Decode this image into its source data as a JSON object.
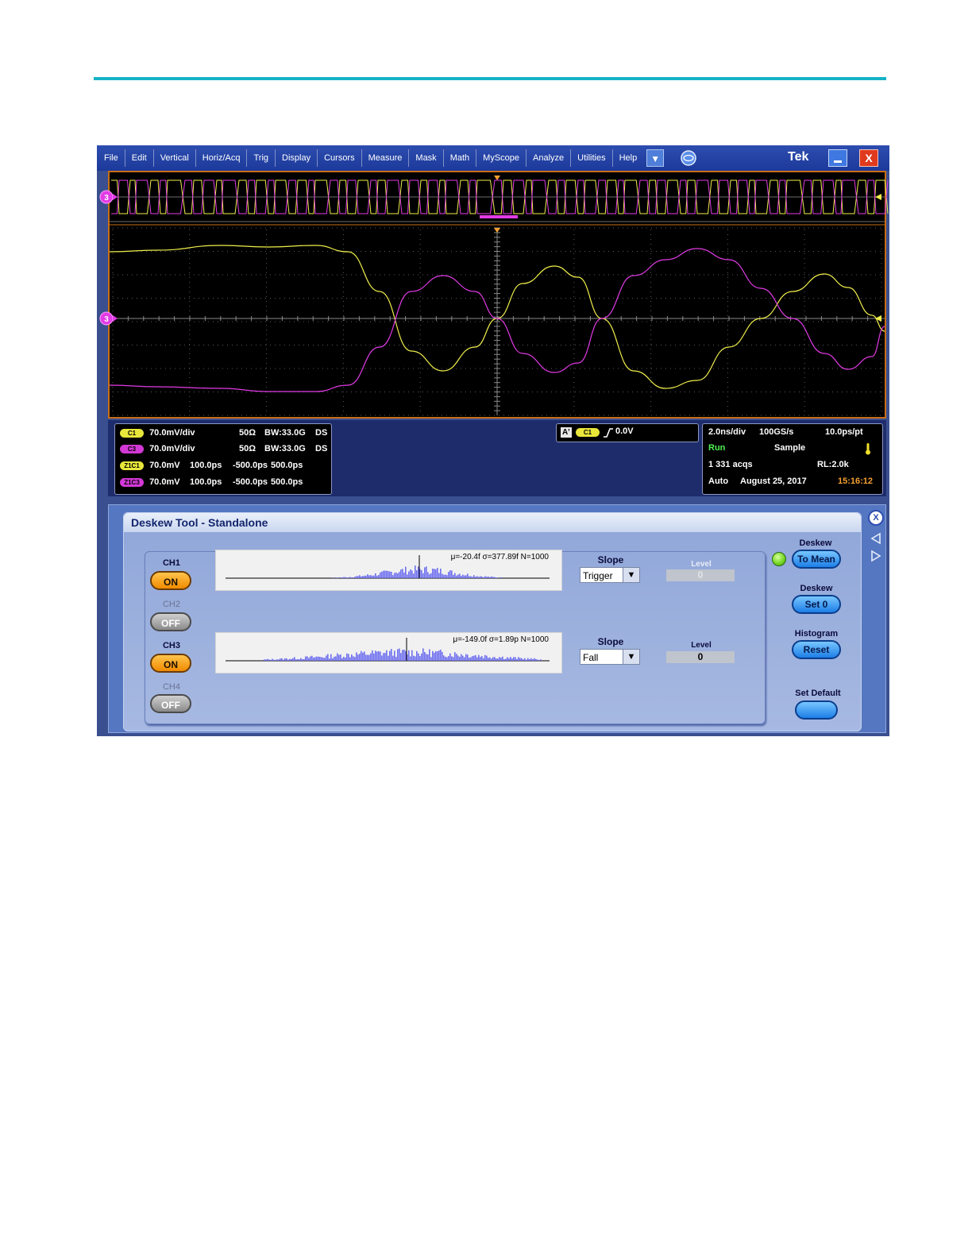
{
  "menu": {
    "items": [
      "File",
      "Edit",
      "Vertical",
      "Horiz/Acq",
      "Trig",
      "Display",
      "Cursors",
      "Measure",
      "Mask",
      "Math",
      "MyScope",
      "Analyze",
      "Utilities",
      "Help"
    ],
    "brand": "Tek",
    "close_glyph": "X"
  },
  "scope": {
    "marker": "3",
    "channel_colors": {
      "ch1": "#f0ef4a",
      "ch3": "#e23be6"
    }
  },
  "readouts": {
    "channels": [
      {
        "badge": "C1",
        "color": "#e8e63a",
        "scale": "70.0mV/div",
        "imp": "50Ω",
        "bw": "BW:33.0G",
        "ds": "DS"
      },
      {
        "badge": "C3",
        "color": "#d238d6",
        "scale": "70.0mV/div",
        "imp": "50Ω",
        "bw": "BW:33.0G",
        "ds": "DS"
      },
      {
        "badge": "Z1C1",
        "color": "#e8e63a",
        "scale": "70.0mV",
        "t1": "100.0ps",
        "t2": "-500.0ps",
        "t3": "500.0ps"
      },
      {
        "badge": "Z1C3",
        "color": "#d238d6",
        "scale": "70.0mV",
        "t1": "100.0ps",
        "t2": "-500.0ps",
        "t3": "500.0ps"
      }
    ],
    "trigger": {
      "mode": "A'",
      "source": "C1",
      "level": "0.0V"
    },
    "horizontal": {
      "timebase": "2.0ns/div",
      "rate": "100GS/s",
      "resolution": "10.0ps/pt",
      "state": "Run",
      "acq_mode": "Sample",
      "acqs": "1 331 acqs",
      "record_length": "RL:2.0k",
      "trigger_mode": "Auto",
      "date": "August 25, 2017",
      "time": "15:16:12"
    }
  },
  "deskew": {
    "title": "Deskew Tool - Standalone",
    "channels": [
      {
        "name": "CH1",
        "state": "ON"
      },
      {
        "name": "CH2",
        "state": "OFF"
      },
      {
        "name": "CH3",
        "state": "ON"
      },
      {
        "name": "CH4",
        "state": "OFF"
      }
    ],
    "histograms": [
      {
        "stats": "μ=-20.4f σ=377.89f N=1000",
        "slope_label": "Slope",
        "slope": "Trigger",
        "level_label": "Level",
        "level": "0"
      },
      {
        "stats": "μ=-149.0f σ=1.89p N=1000",
        "slope_label": "Slope",
        "slope": "Fall",
        "level_label": "Level",
        "level": "0"
      }
    ],
    "right": {
      "deskew_label": "Deskew",
      "to_mean": "To Mean",
      "deskew_label2": "Deskew",
      "set0": "Set 0",
      "histogram_label": "Histogram",
      "reset": "Reset",
      "set_default_label": "Set Default",
      "set_default": ""
    },
    "close_glyph": "X"
  }
}
